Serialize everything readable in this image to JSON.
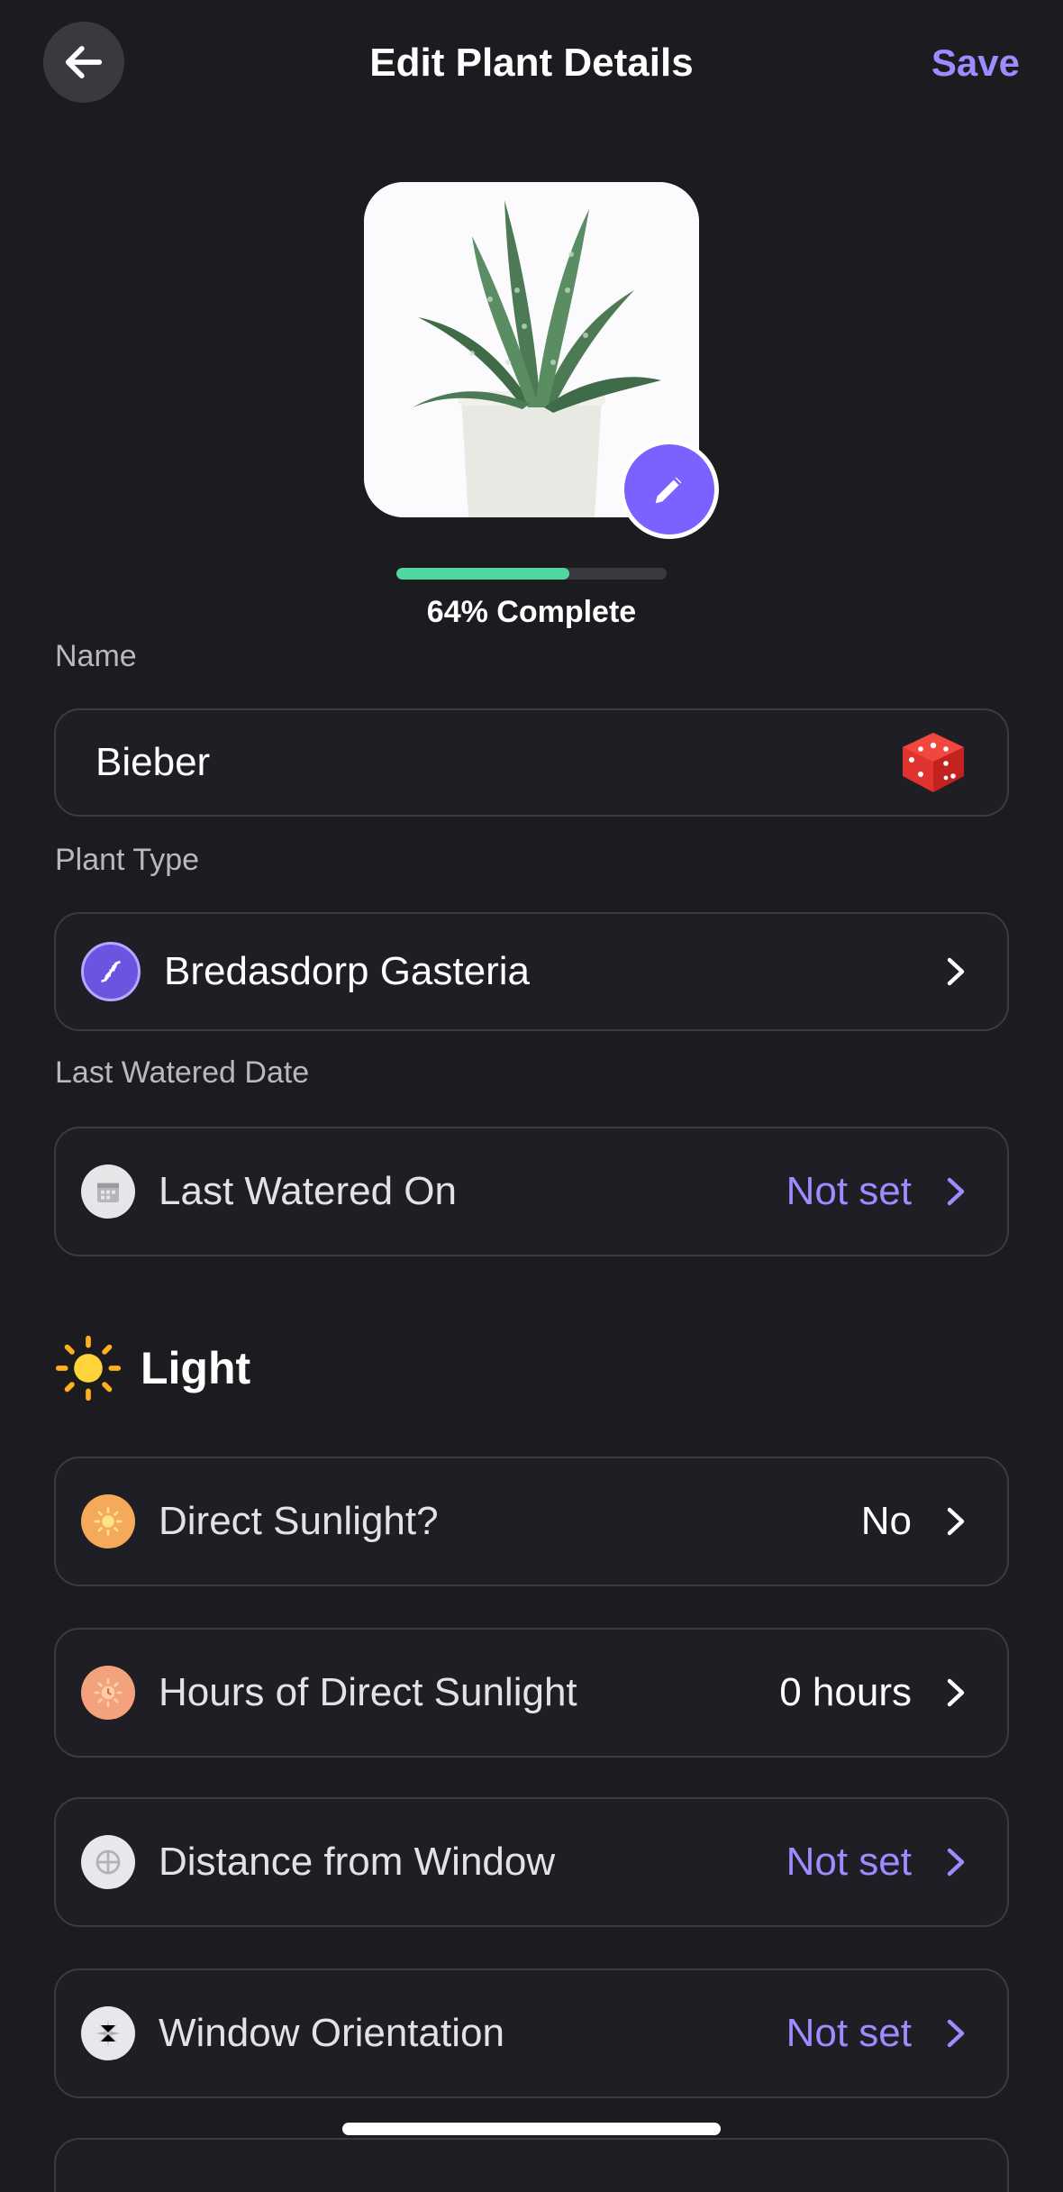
{
  "header": {
    "title": "Edit Plant Details",
    "save_label": "Save"
  },
  "progress": {
    "percent": 64,
    "label": "64% Complete"
  },
  "name": {
    "label": "Name",
    "value": "Bieber"
  },
  "plant_type": {
    "label": "Plant Type",
    "value": "Bredasdorp Gasteria"
  },
  "last_watered": {
    "label": "Last Watered Date",
    "row_label": "Last Watered On",
    "value": "Not set"
  },
  "light": {
    "heading": "Light",
    "rows": [
      {
        "label": "Direct Sunlight?",
        "value": "No"
      },
      {
        "label": "Hours of Direct Sunlight",
        "value": "0 hours"
      },
      {
        "label": "Distance from Window",
        "value": "Not set"
      },
      {
        "label": "Window Orientation",
        "value": "Not set"
      }
    ]
  },
  "colors": {
    "accent": "#7b61ff",
    "accent_text": "#9b8cff",
    "progress": "#4fd6a1",
    "background": "#1c1b20"
  }
}
